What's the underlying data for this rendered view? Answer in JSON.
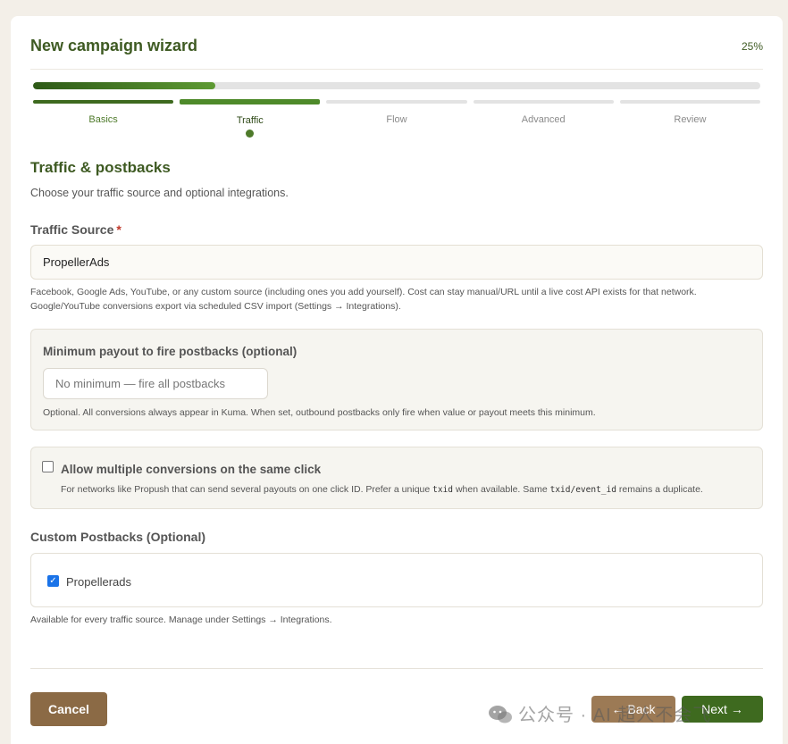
{
  "header": {
    "title": "New campaign wizard",
    "percent": "25%"
  },
  "progress": {
    "fraction": 0.25
  },
  "steps": [
    {
      "label": "Basics",
      "state": "done"
    },
    {
      "label": "Traffic",
      "state": "active"
    },
    {
      "label": "Flow",
      "state": "pending"
    },
    {
      "label": "Advanced",
      "state": "pending"
    },
    {
      "label": "Review",
      "state": "pending"
    }
  ],
  "section": {
    "title": "Traffic & postbacks",
    "subtitle": "Choose your traffic source and optional integrations."
  },
  "traffic_source": {
    "label": "Traffic Source",
    "required_mark": "*",
    "value": "PropellerAds",
    "help_line1": "Facebook, Google Ads, YouTube, or any custom source (including ones you add yourself). Cost can stay manual/URL until a live cost API exists for that network.",
    "help_line2": "Google/YouTube conversions export via scheduled CSV import (Settings → Integrations)."
  },
  "min_payout": {
    "title": "Minimum payout to fire postbacks (optional)",
    "placeholder": "No minimum — fire all postbacks",
    "value": "",
    "help": "Optional. All conversions always appear in Kuma. When set, outbound postbacks only fire when value or payout meets this minimum."
  },
  "multi_conv": {
    "checked": false,
    "title": "Allow multiple conversions on the same click",
    "help_a": "For networks like Propush that can send several payouts on one click ID. Prefer a unique ",
    "code_a": "txid",
    "help_b": " when available. Same ",
    "code_b": "txid/event_id",
    "help_c": " remains a duplicate."
  },
  "custom_postbacks": {
    "title": "Custom Postbacks (Optional)",
    "items": [
      {
        "label": "Propellerads",
        "checked": true
      }
    ],
    "help": "Available for every traffic source. Manage under Settings → Integrations."
  },
  "footer": {
    "cancel": "Cancel",
    "back": "← Back",
    "next": "Next →"
  },
  "watermark": {
    "text": "公众号 · AI 超人不会飞"
  },
  "colors": {
    "accent_green": "#3e6a1f",
    "title_green": "#3e5a22",
    "cancel_brown": "#8b6a45",
    "page_bg": "#f3efe8"
  }
}
